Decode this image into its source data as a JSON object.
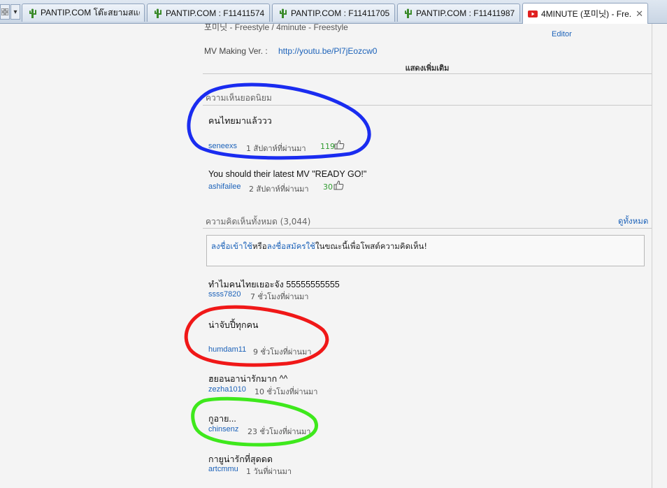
{
  "tabs": [
    {
      "title": "PANTIP.COM โต๊ะสยามสแค...",
      "icon": "cactus-icon",
      "active": false
    },
    {
      "title": "PANTIP.COM : F11411574 ...",
      "icon": "cactus-icon",
      "active": false
    },
    {
      "title": "PANTIP.COM : F11411705 ...",
      "icon": "cactus-icon",
      "active": false
    },
    {
      "title": "PANTIP.COM : F11411987 ...",
      "icon": "cactus-icon",
      "active": false
    },
    {
      "title": "4MINUTE (포미닛) - Fre...",
      "icon": "youtube-icon",
      "active": true
    }
  ],
  "description": {
    "line_partial": "포미닛 - Freestyle / 4minute - Freestyle",
    "mv_label": "MV Making Ver. :",
    "mv_link": "http://youtu.be/Pl7jEozcw0",
    "show_more": "แสดงเพิ่มเติม",
    "side_partial": "Editor"
  },
  "top_comments": {
    "title": "ความเห็นยอดนิยม",
    "items": [
      {
        "text": "คนไทยมาแล้ววว",
        "user": "seneexs",
        "time": "1 สัปดาห์ที่ผ่านมา",
        "likes": "119"
      },
      {
        "text": "You should their latest MV \"READY GO!\"",
        "user": "ashifailee",
        "time": "2 สัปดาห์ที่ผ่านมา",
        "likes": "30"
      }
    ]
  },
  "all_comments": {
    "title": "ความคิดเห็นทั้งหมด (3,044)",
    "view_all": "ดูทั้งหมด",
    "login_prompt": {
      "sign_in": "ลงชื่อเข้าใช้",
      "or": "หรือ",
      "sign_up": "ลงชื่อสมัครใช้",
      "rest": "ในขณะนี้เพื่อโพสต์ความคิดเห็น!"
    },
    "items": [
      {
        "text": "ทำไมคนไทยเยอะจัง 55555555555",
        "user": "ssss7820",
        "time": "7 ชั่วโมงที่ผ่านมา"
      },
      {
        "text": "น่าจับปี้ทุกคน",
        "user": "humdam11",
        "time": "9 ชั่วโมงที่ผ่านมา"
      },
      {
        "text": "ฮยอนอาน่ารักมาก ^^",
        "user": "zezha1010",
        "time": "10 ชั่วโมงที่ผ่านมา"
      },
      {
        "text": "กูอาย...",
        "user": "chinsenz",
        "time": "23 ชั่วโมงที่ผ่านมา"
      },
      {
        "text": "กายูน่ารักที่สุดดด",
        "user": "artcmmu",
        "time": "1 วันที่ผ่านมา"
      }
    ]
  },
  "colors": {
    "blue_annotation": "#1a2cf0",
    "red_annotation": "#f01818",
    "green_annotation": "#3ee81c",
    "link": "#1c62b9"
  }
}
